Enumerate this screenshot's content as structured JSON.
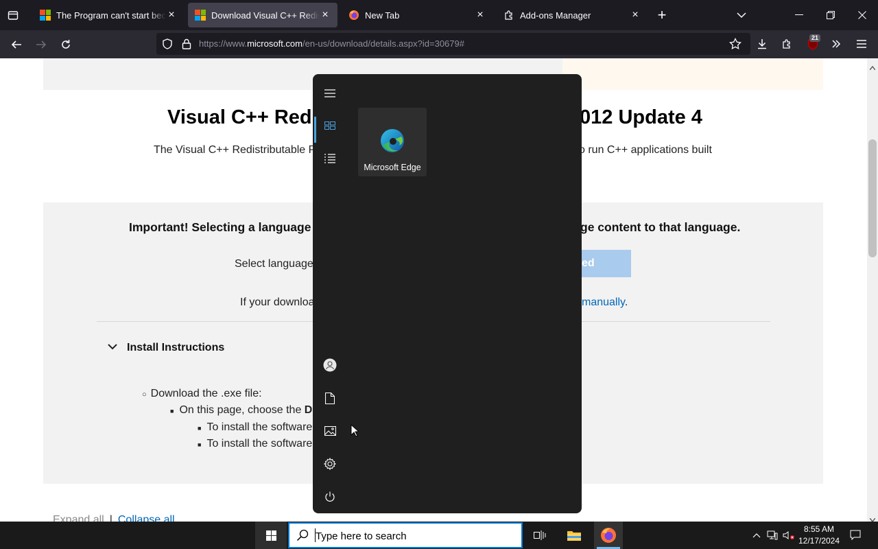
{
  "browser": {
    "tabs": [
      {
        "title": "The Program can't start because",
        "favicon": "microsoft-logo",
        "active": false
      },
      {
        "title": "Download Visual C++ Redistributable",
        "favicon": "microsoft-logo",
        "active": true
      },
      {
        "title": "New Tab",
        "favicon": "firefox-logo",
        "active": false
      },
      {
        "title": "Add-ons Manager",
        "favicon": "puzzle-icon",
        "active": false
      }
    ],
    "url_prefix": "https://www.",
    "url_domain": "microsoft.com",
    "url_path": "/en-us/download/details.aspx?id=30679#",
    "extension_badge": "21"
  },
  "page": {
    "title_left": "Visual C++ Redi",
    "title_right": "012 Update 4",
    "desc_left": "The Visual C++ Redistributable P",
    "desc_right": "o run C++ applications built",
    "important_left": "Important! Selecting a language",
    "important_right": "ge content to that language.",
    "select_language": "Select language",
    "download_button": "ed",
    "if_download": "If your downloa",
    "manually_link": "manually",
    "period": ".",
    "install_instructions": "Install Instructions",
    "bullets": [
      "Download the .exe file:",
      "On this page, choose the ",
      "To install the software",
      "To install the software"
    ],
    "bullet_bold": "Do",
    "expand_all": "Expand all",
    "separator": "|",
    "collapse_all": "Collapse all"
  },
  "start_menu": {
    "pinned_app": "Microsoft Edge",
    "rail_icons": [
      "hamburger-icon",
      "tiles-icon",
      "all-apps-list-icon",
      "user-icon",
      "documents-icon",
      "pictures-icon",
      "settings-icon",
      "power-icon"
    ]
  },
  "taskbar": {
    "search_placeholder": "Type here to search",
    "time": "8:55 AM",
    "date": "12/17/2024"
  },
  "colors": {
    "accent": "#0078d4",
    "link": "#0067b8",
    "start_bg": "#1f1f1f",
    "tab_active": "#42414d"
  }
}
